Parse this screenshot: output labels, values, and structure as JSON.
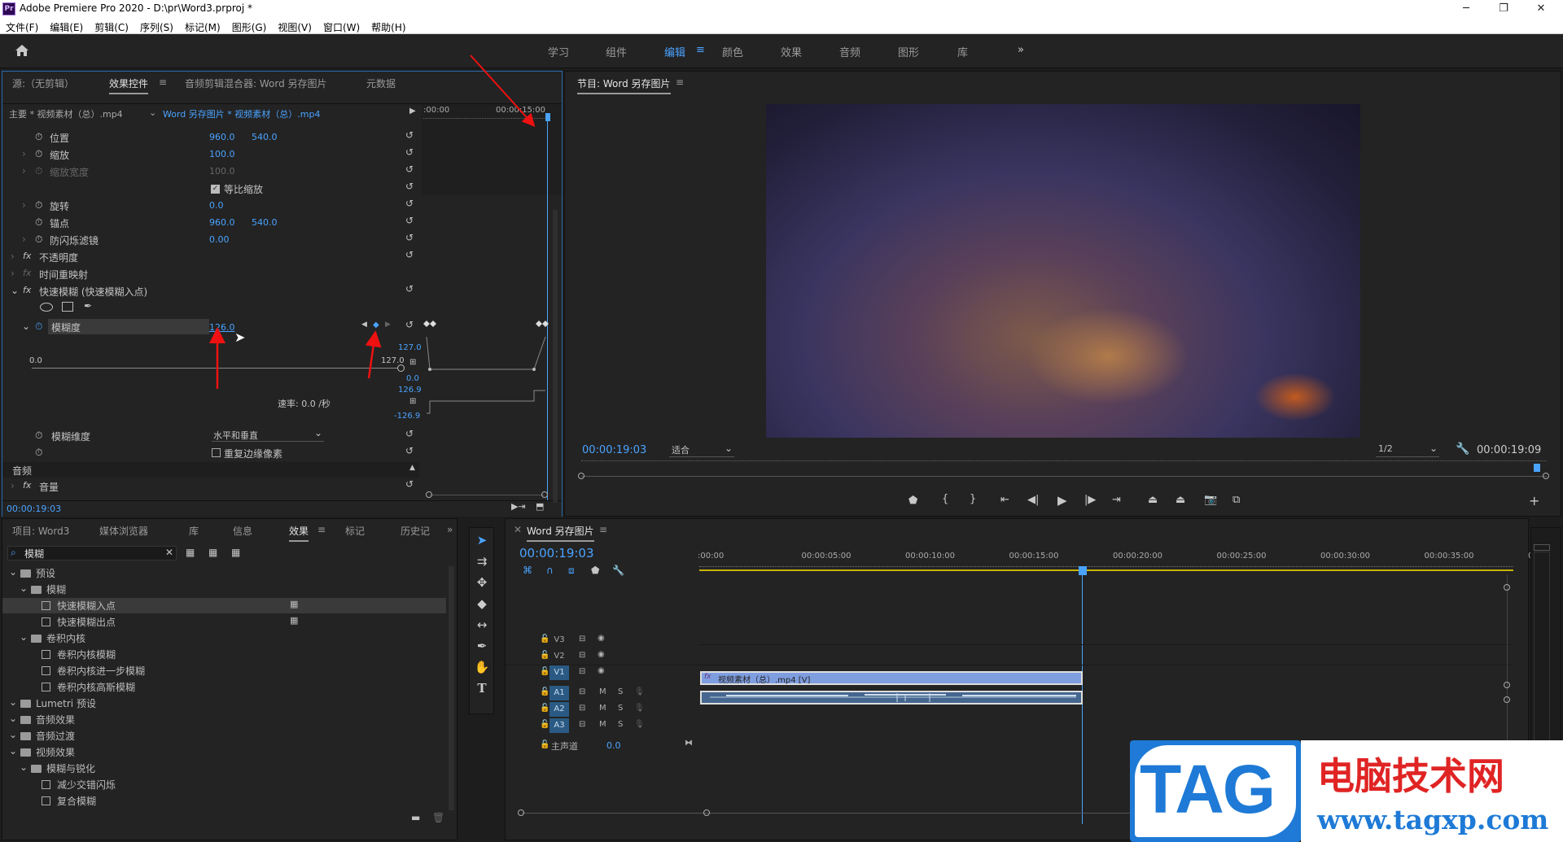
{
  "app": {
    "title": "Adobe Premiere Pro 2020 - D:\\pr\\Word3.prproj *",
    "icon": "Pr"
  },
  "window_controls": {
    "minimize": "─",
    "maximize": "❐",
    "close": "✕"
  },
  "menu": [
    "文件(F)",
    "编辑(E)",
    "剪辑(C)",
    "序列(S)",
    "标记(M)",
    "图形(G)",
    "视图(V)",
    "窗口(W)",
    "帮助(H)"
  ],
  "workspaces": [
    "学习",
    "组件",
    "编辑",
    "颜色",
    "效果",
    "音频",
    "图形",
    "库"
  ],
  "workspace_active": "编辑",
  "effects_panel": {
    "tabs": [
      "源:（无剪辑）",
      "效果控件",
      "音频剪辑混合器: Word 另存图片",
      "元数据"
    ],
    "master_clip": "主要 * 视频素材（总）.mp4",
    "seq_clip": "Word 另存图片 * 视频素材（总）.mp4",
    "ruler_start": ":00:00",
    "ruler_end": "00:00:15:00",
    "props": {
      "position": {
        "label": "位置",
        "x": "960.0",
        "y": "540.0"
      },
      "scale": {
        "label": "缩放",
        "v": "100.0"
      },
      "scale_width": {
        "label": "缩放宽度",
        "v": "100.0"
      },
      "uniform": {
        "label": "等比缩放"
      },
      "rotation": {
        "label": "旋转",
        "v": "0.0"
      },
      "anchor": {
        "label": "锚点",
        "x": "960.0",
        "y": "540.0"
      },
      "flicker": {
        "label": "防闪烁滤镜",
        "v": "0.00"
      },
      "opacity": {
        "label": "不透明度"
      },
      "time_remap": {
        "label": "时间重映射"
      },
      "fast_blur": {
        "label": "快速模糊 (快速模糊入点)"
      },
      "blurriness": {
        "label": "模糊度",
        "v": "126.0"
      },
      "graph_min": "0.0",
      "graph_max": "127.0",
      "graph_max_r": "127.0",
      "graph_zero_r": "0.0",
      "vel_top": "126.9",
      "vel_bottom": "-126.9",
      "rate": "速率: 0.0 /秒",
      "blur_dims": {
        "label": "模糊维度",
        "v": "水平和垂直"
      },
      "repeat_edge": {
        "label": "重复边缘像素"
      },
      "audio_section": "音频",
      "volume": {
        "label": "音量"
      }
    },
    "current_time": "00:00:19:03"
  },
  "program": {
    "title": "节目: Word 另存图片",
    "timecode": "00:00:19:03",
    "fit": "适合",
    "quality": "1/2",
    "duration": "00:00:19:09"
  },
  "project_panel": {
    "tabs": [
      "项目: Word3",
      "媒体浏览器",
      "库",
      "信息",
      "效果",
      "标记",
      "历史记"
    ],
    "search_value": "模糊",
    "tree": [
      {
        "label": "预设",
        "level": 0,
        "type": "folder"
      },
      {
        "label": "模糊",
        "level": 1,
        "type": "folder"
      },
      {
        "label": "快速模糊入点",
        "level": 2,
        "type": "preset",
        "selected": true
      },
      {
        "label": "快速模糊出点",
        "level": 2,
        "type": "preset"
      },
      {
        "label": "卷积内核",
        "level": 1,
        "type": "folder"
      },
      {
        "label": "卷积内核模糊",
        "level": 2,
        "type": "preset"
      },
      {
        "label": "卷积内核进一步模糊",
        "level": 2,
        "type": "preset"
      },
      {
        "label": "卷积内核高斯模糊",
        "level": 2,
        "type": "preset"
      },
      {
        "label": "Lumetri 预设",
        "level": 0,
        "type": "folder"
      },
      {
        "label": "音频效果",
        "level": 0,
        "type": "folder"
      },
      {
        "label": "音频过渡",
        "level": 0,
        "type": "folder"
      },
      {
        "label": "视频效果",
        "level": 0,
        "type": "folder"
      },
      {
        "label": "模糊与锐化",
        "level": 1,
        "type": "folder"
      },
      {
        "label": "减少交错闪烁",
        "level": 2,
        "type": "preset"
      },
      {
        "label": "复合模糊",
        "level": 2,
        "type": "preset"
      }
    ]
  },
  "timeline": {
    "title": "Word 另存图片",
    "timecode": "00:00:19:03",
    "ruler": [
      ":00:00",
      "00:00:05:00",
      "00:00:10:00",
      "00:00:15:00",
      "00:00:20:00",
      "00:00:25:00",
      "00:00:30:00",
      "00:00:35:00",
      "00:0"
    ],
    "tracks_v": [
      "V3",
      "V2",
      "V1"
    ],
    "tracks_a": [
      "A1",
      "A2",
      "A3"
    ],
    "master": "主声道",
    "master_val": "0.0",
    "video_clip": "视频素材（总）.mp4 [V]",
    "m": "M",
    "s": "S"
  },
  "watermark": {
    "tag": "TAG",
    "site": "电脑技术网",
    "url": "www.tagxp.com"
  },
  "colors": {
    "accent": "#4aa3ff",
    "panel": "#232323",
    "bg": "#1d1d1d"
  }
}
